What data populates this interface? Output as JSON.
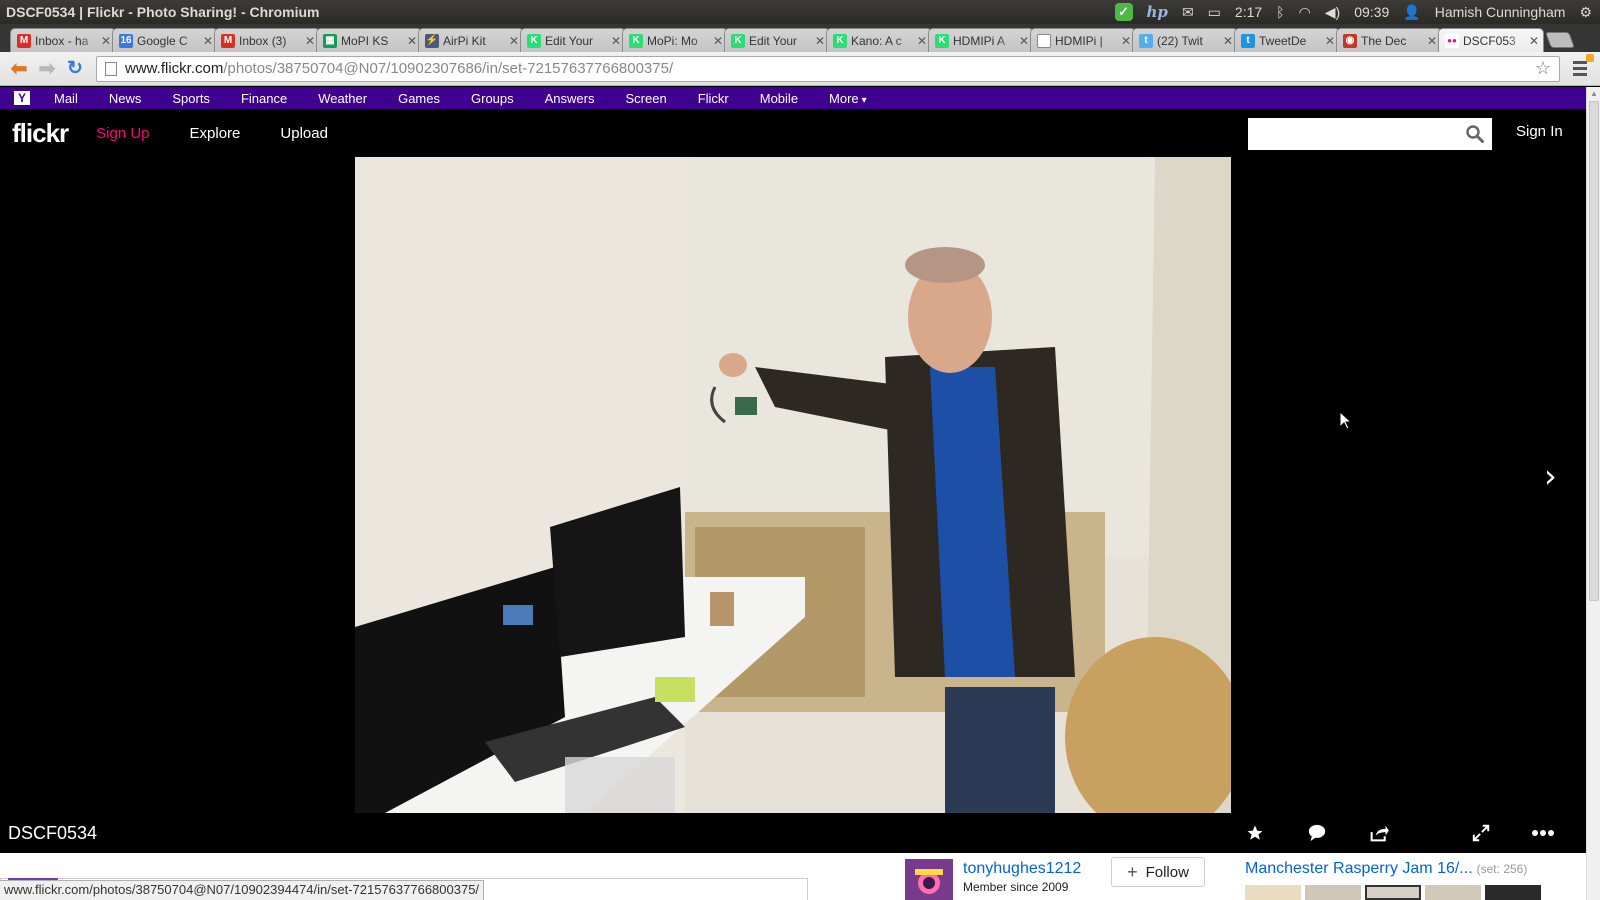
{
  "os_panel": {
    "window_title": "DSCF0534 | Flickr - Photo Sharing! - Chromium",
    "battery_time": "2:17",
    "clock": "09:39",
    "user_name": "Hamish Cunningham"
  },
  "tabs": [
    {
      "label": "Inbox - ha",
      "favicon": "gmail-icon",
      "color": "#d93025",
      "glyph": "M"
    },
    {
      "label": "Google C",
      "favicon": "google-calendar-icon",
      "color": "#3b78e7",
      "glyph": "16"
    },
    {
      "label": "Inbox (3)",
      "favicon": "gmail-icon",
      "color": "#d93025",
      "glyph": "M"
    },
    {
      "label": "MoPI KS",
      "favicon": "sheets-icon",
      "color": "#0f9d58",
      "glyph": "▦"
    },
    {
      "label": "AirPi Kit",
      "favicon": "bolt-icon",
      "color": "#4a5a78",
      "glyph": "⚡"
    },
    {
      "label": "Edit Your",
      "favicon": "kickstarter-icon",
      "color": "#2bde73",
      "glyph": "K"
    },
    {
      "label": "MoPi: Mo",
      "favicon": "kickstarter-icon",
      "color": "#2bde73",
      "glyph": "K"
    },
    {
      "label": "Edit Your",
      "favicon": "kickstarter-icon",
      "color": "#2bde73",
      "glyph": "K"
    },
    {
      "label": "Kano: A c",
      "favicon": "kickstarter-icon",
      "color": "#2bde73",
      "glyph": "K"
    },
    {
      "label": "HDMIPi A",
      "favicon": "kickstarter-icon",
      "color": "#2bde73",
      "glyph": "K"
    },
    {
      "label": "HDMIPi |",
      "favicon": "page-icon",
      "color": "#ffffff",
      "glyph": ""
    },
    {
      "label": "(22) Twit",
      "favicon": "twitter-icon",
      "color": "#55acee",
      "glyph": "t"
    },
    {
      "label": "TweetDe",
      "favicon": "tweetdeck-icon",
      "color": "#1b95e0",
      "glyph": "t"
    },
    {
      "label": "The Dec",
      "favicon": "decoder-icon",
      "color": "#c0392b",
      "glyph": "◉"
    },
    {
      "label": "DSCF053",
      "favicon": "flickr-icon",
      "color": "#ffffff",
      "glyph": "●●",
      "active": true
    }
  ],
  "toolbar": {
    "url_host": "www.flickr.com",
    "url_path": "/photos/38750704@N07/10902307686/in/set-72157637766800375/"
  },
  "yahoo_bar": {
    "logo": "Y",
    "links": [
      "Mail",
      "News",
      "Sports",
      "Finance",
      "Weather",
      "Games",
      "Groups",
      "Answers",
      "Screen",
      "Flickr",
      "Mobile"
    ],
    "more_label": "More"
  },
  "flickr_header": {
    "logo": "flickr",
    "signup": "Sign Up",
    "explore": "Explore",
    "upload": "Upload",
    "search_placeholder": "",
    "signin": "Sign In"
  },
  "photo": {
    "title": "DSCF0534"
  },
  "owner": {
    "name": "tonyhughes1212",
    "member_since": "Member since 2009",
    "follow_label": "Follow"
  },
  "set": {
    "title": "Manchester Rasperry Jam 16/...",
    "count": "(set: 256)"
  },
  "status_bubble": "www.flickr.com/photos/38750704@N07/10902394474/in/set-72157637766800375/",
  "colors": {
    "flickr_pink": "#ff0084",
    "flickr_blue": "#0063dc",
    "yahoo_purple": "#400090"
  }
}
